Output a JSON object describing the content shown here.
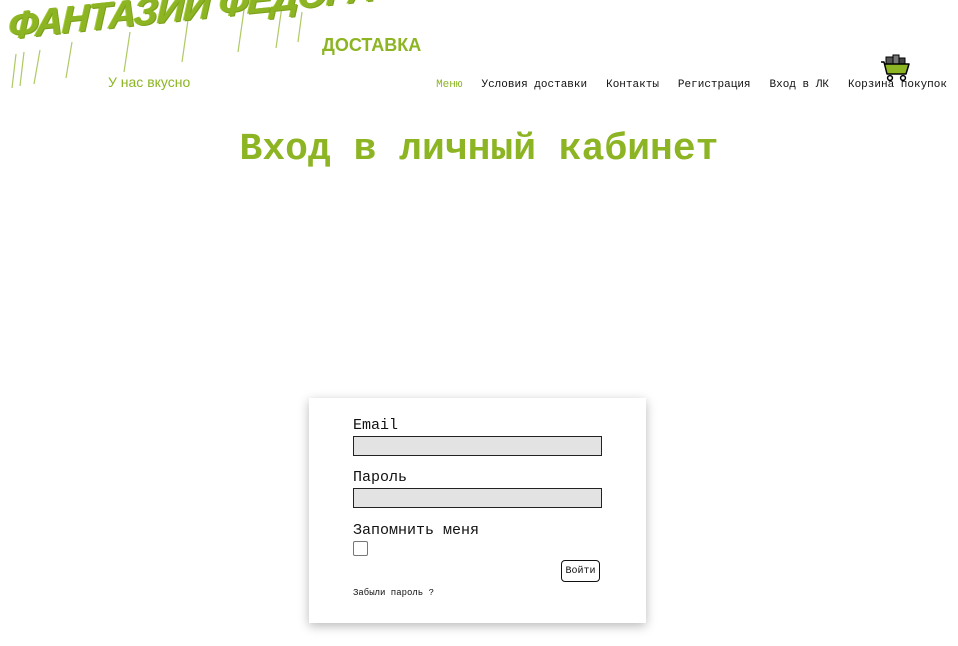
{
  "header": {
    "logo_title": "ФАНТАЗИИ ФЕДОРА",
    "logo_tagline": "У нас вкусно",
    "brand_word": "ДОСТАВКА",
    "cart_icon": "shopping-cart-icon",
    "nav": [
      {
        "label": "Меню",
        "active": true
      },
      {
        "label": "Условия доставки",
        "active": false
      },
      {
        "label": "Контакты",
        "active": false
      },
      {
        "label": "Регистрация",
        "active": false
      },
      {
        "label": "Вход в ЛК",
        "active": false
      },
      {
        "label": "Корзина покупок",
        "active": false
      }
    ]
  },
  "main": {
    "title": "Вход в личный кабинет"
  },
  "login_form": {
    "email_label": "Email",
    "email_value": "",
    "password_label": "Пароль",
    "password_value": "",
    "remember_label": "Запомнить меня",
    "remember_checked": false,
    "submit_label": "Войти",
    "forgot_label": "Забыли пароль ?"
  },
  "colors": {
    "accent": "#8cb423",
    "input_bg": "#e3e3e3",
    "text": "#111111"
  }
}
